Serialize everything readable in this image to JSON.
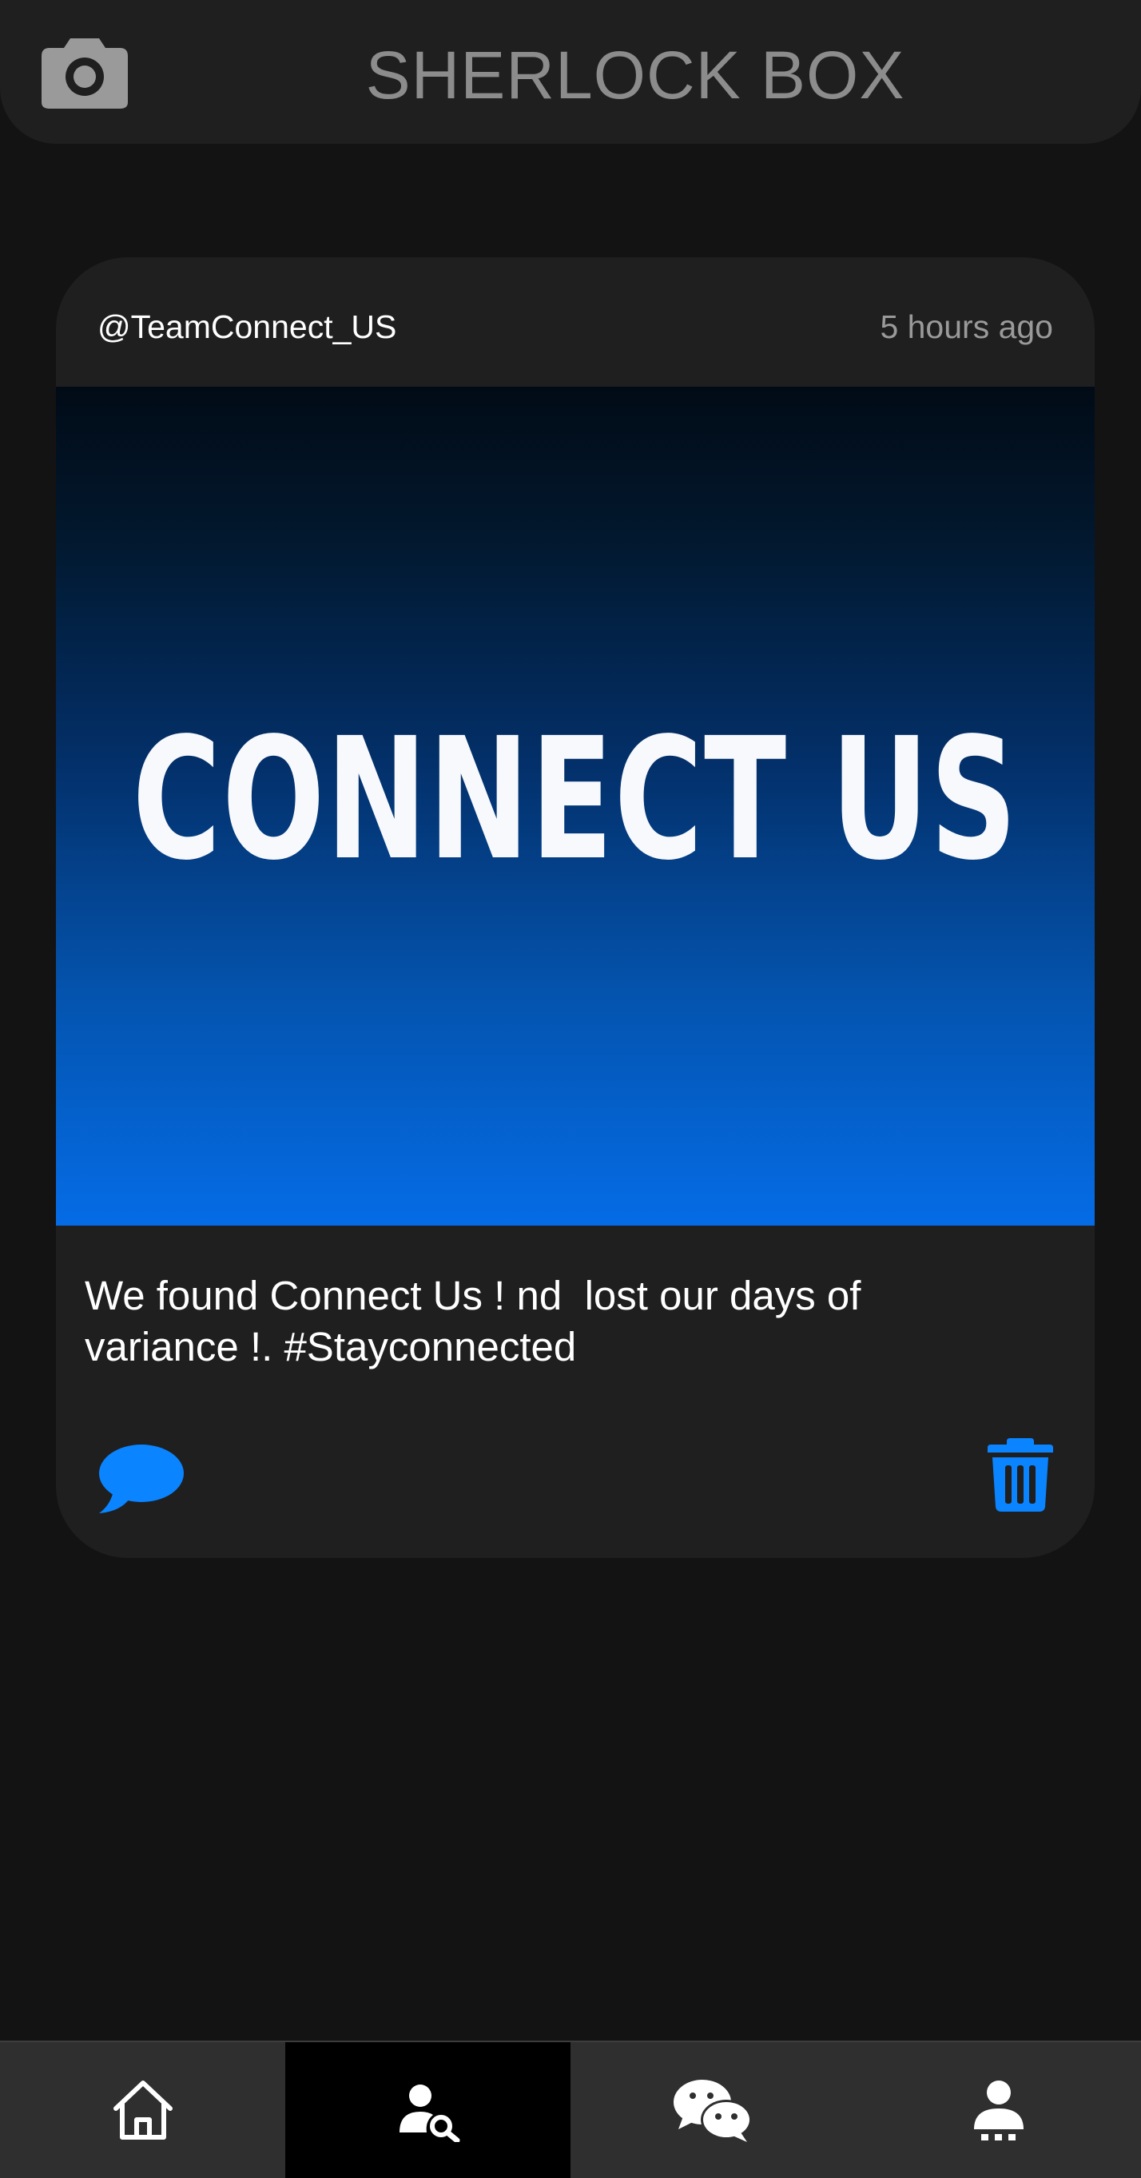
{
  "header": {
    "title": "SHERLOCK BOX",
    "camera_icon": "camera-icon"
  },
  "post": {
    "author": "@TeamConnect_US",
    "time": "5 hours ago",
    "image_text": "CONNECT US",
    "caption": "We found Connect Us ! nd  lost our days of\nvariance !. #Stayconnected",
    "comment_icon": "comment-bubble-icon",
    "delete_icon": "trash-icon"
  },
  "nav": {
    "items": [
      {
        "id": "home",
        "icon": "home-icon"
      },
      {
        "id": "search-people",
        "icon": "user-search-icon",
        "active": true
      },
      {
        "id": "chat",
        "icon": "chat-bubbles-icon"
      },
      {
        "id": "profile",
        "icon": "user-icon"
      }
    ]
  },
  "colors": {
    "background": "#131313",
    "surface": "#1f1f1f",
    "nav_background": "#2f2f2f",
    "nav_active": "#000000",
    "accent": "#0a84ff",
    "muted_text": "#8c8c8c"
  }
}
